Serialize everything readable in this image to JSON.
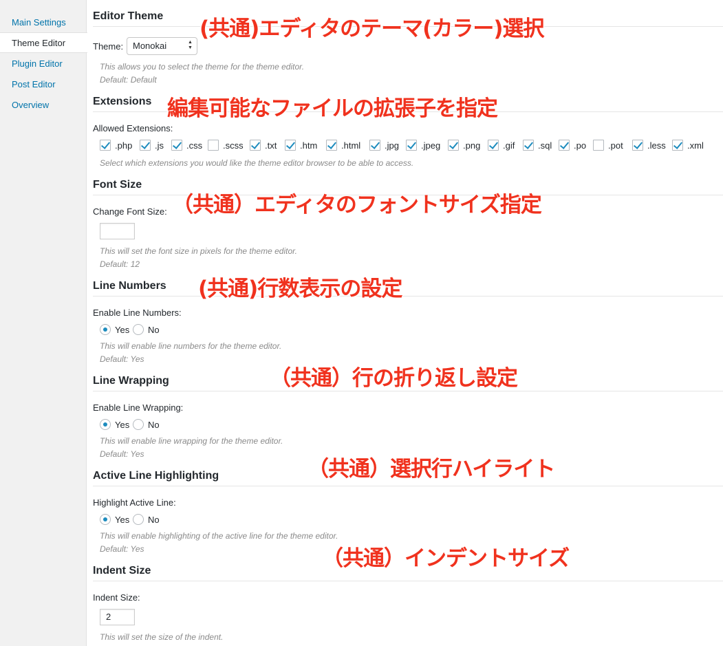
{
  "nav": {
    "items": [
      {
        "label": "Main Settings",
        "active": false
      },
      {
        "label": "Theme Editor",
        "active": true
      },
      {
        "label": "Plugin Editor",
        "active": false
      },
      {
        "label": "Post Editor",
        "active": false
      },
      {
        "label": "Overview",
        "active": false
      }
    ]
  },
  "sections": {
    "theme": {
      "title": "Editor Theme",
      "label": "Theme:",
      "selected": "Monokai",
      "desc": "This allows you to select the theme for the theme editor.",
      "default": "Default: Default",
      "note": "(共通)エディタのテーマ(カラー)選択"
    },
    "extensions": {
      "title": "Extensions",
      "label": "Allowed Extensions:",
      "items": [
        {
          "ext": ".php",
          "checked": true
        },
        {
          "ext": ".js",
          "checked": true
        },
        {
          "ext": ".css",
          "checked": true
        },
        {
          "ext": ".scss",
          "checked": false
        },
        {
          "ext": ".txt",
          "checked": true
        },
        {
          "ext": ".htm",
          "checked": true
        },
        {
          "ext": ".html",
          "checked": true
        },
        {
          "ext": ".jpg",
          "checked": true
        },
        {
          "ext": ".jpeg",
          "checked": true
        },
        {
          "ext": ".png",
          "checked": true
        },
        {
          "ext": ".gif",
          "checked": true
        },
        {
          "ext": ".sql",
          "checked": true
        },
        {
          "ext": ".po",
          "checked": true
        },
        {
          "ext": ".pot",
          "checked": false
        },
        {
          "ext": ".less",
          "checked": true
        },
        {
          "ext": ".xml",
          "checked": true
        }
      ],
      "desc": "Select which extensions you would like the theme editor browser to be able to access.",
      "note": "編集可能なファイルの拡張子を指定"
    },
    "font": {
      "title": "Font Size",
      "label": "Change Font Size:",
      "value": "",
      "desc": "This will set the font size in pixels for the theme editor.",
      "default": "Default: 12",
      "note": "（共通）エディタのフォントサイズ指定"
    },
    "line_numbers": {
      "title": "Line Numbers",
      "label": "Enable Line Numbers:",
      "yes": "Yes",
      "no": "No",
      "desc": "This will enable line numbers for the theme editor.",
      "default": "Default: Yes",
      "note": "(共通)行数表示の設定"
    },
    "line_wrapping": {
      "title": "Line Wrapping",
      "label": "Enable Line Wrapping:",
      "yes": "Yes",
      "no": "No",
      "desc": "This will enable line wrapping for the theme editor.",
      "default": "Default: Yes",
      "note": "（共通）行の折り返し設定"
    },
    "active_line": {
      "title": "Active Line Highlighting",
      "label": "Highlight Active Line:",
      "yes": "Yes",
      "no": "No",
      "desc": "This will enable highlighting of the active line for the theme editor.",
      "default": "Default: Yes",
      "note": "（共通）選択行ハイライト"
    },
    "indent": {
      "title": "Indent Size",
      "label": "Indent Size:",
      "value": "2",
      "desc": "This will set the size of the indent.",
      "note": "（共通）インデントサイズ"
    }
  },
  "colors": {
    "link": "#0073aa",
    "accent": "#1e8cbe",
    "annotation": "#f0321e"
  }
}
